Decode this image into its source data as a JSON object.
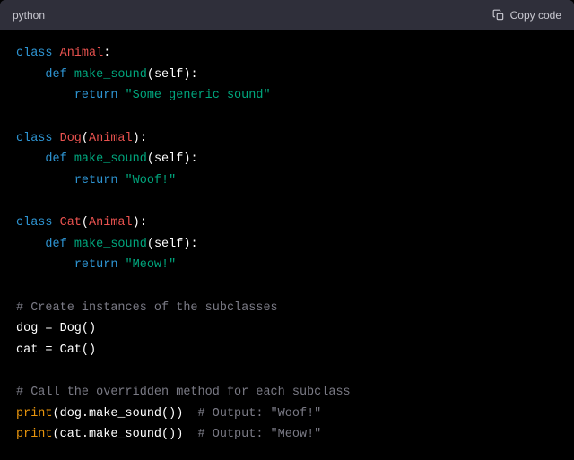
{
  "header": {
    "language": "python",
    "copy_label": "Copy code"
  },
  "code": {
    "lines": [
      {
        "segments": [
          {
            "t": "class ",
            "c": "kw"
          },
          {
            "t": "Animal",
            "c": "cls"
          },
          {
            "t": ":",
            "c": "plain"
          }
        ]
      },
      {
        "segments": [
          {
            "t": "    ",
            "c": "plain"
          },
          {
            "t": "def ",
            "c": "kw"
          },
          {
            "t": "make_sound",
            "c": "fn"
          },
          {
            "t": "(",
            "c": "plain"
          },
          {
            "t": "self",
            "c": "self"
          },
          {
            "t": "):",
            "c": "plain"
          }
        ]
      },
      {
        "segments": [
          {
            "t": "        ",
            "c": "plain"
          },
          {
            "t": "return ",
            "c": "kw"
          },
          {
            "t": "\"Some generic sound\"",
            "c": "str"
          }
        ]
      },
      {
        "segments": []
      },
      {
        "segments": [
          {
            "t": "class ",
            "c": "kw"
          },
          {
            "t": "Dog",
            "c": "cls"
          },
          {
            "t": "(",
            "c": "plain"
          },
          {
            "t": "Animal",
            "c": "cls"
          },
          {
            "t": "):",
            "c": "plain"
          }
        ]
      },
      {
        "segments": [
          {
            "t": "    ",
            "c": "plain"
          },
          {
            "t": "def ",
            "c": "kw"
          },
          {
            "t": "make_sound",
            "c": "fn"
          },
          {
            "t": "(",
            "c": "plain"
          },
          {
            "t": "self",
            "c": "self"
          },
          {
            "t": "):",
            "c": "plain"
          }
        ]
      },
      {
        "segments": [
          {
            "t": "        ",
            "c": "plain"
          },
          {
            "t": "return ",
            "c": "kw"
          },
          {
            "t": "\"Woof!\"",
            "c": "str"
          }
        ]
      },
      {
        "segments": []
      },
      {
        "segments": [
          {
            "t": "class ",
            "c": "kw"
          },
          {
            "t": "Cat",
            "c": "cls"
          },
          {
            "t": "(",
            "c": "plain"
          },
          {
            "t": "Animal",
            "c": "cls"
          },
          {
            "t": "):",
            "c": "plain"
          }
        ]
      },
      {
        "segments": [
          {
            "t": "    ",
            "c": "plain"
          },
          {
            "t": "def ",
            "c": "kw"
          },
          {
            "t": "make_sound",
            "c": "fn"
          },
          {
            "t": "(",
            "c": "plain"
          },
          {
            "t": "self",
            "c": "self"
          },
          {
            "t": "):",
            "c": "plain"
          }
        ]
      },
      {
        "segments": [
          {
            "t": "        ",
            "c": "plain"
          },
          {
            "t": "return ",
            "c": "kw"
          },
          {
            "t": "\"Meow!\"",
            "c": "str"
          }
        ]
      },
      {
        "segments": []
      },
      {
        "segments": [
          {
            "t": "# Create instances of the subclasses",
            "c": "cmt"
          }
        ]
      },
      {
        "segments": [
          {
            "t": "dog = Dog()",
            "c": "plain"
          }
        ]
      },
      {
        "segments": [
          {
            "t": "cat = Cat()",
            "c": "plain"
          }
        ]
      },
      {
        "segments": []
      },
      {
        "segments": [
          {
            "t": "# Call the overridden method for each subclass",
            "c": "cmt"
          }
        ]
      },
      {
        "segments": [
          {
            "t": "print",
            "c": "builtin"
          },
          {
            "t": "(dog.make_sound())  ",
            "c": "plain"
          },
          {
            "t": "# Output: \"Woof!\"",
            "c": "cmt"
          }
        ]
      },
      {
        "segments": [
          {
            "t": "print",
            "c": "builtin"
          },
          {
            "t": "(cat.make_sound())  ",
            "c": "plain"
          },
          {
            "t": "# Output: \"Meow!\"",
            "c": "cmt"
          }
        ]
      }
    ]
  }
}
